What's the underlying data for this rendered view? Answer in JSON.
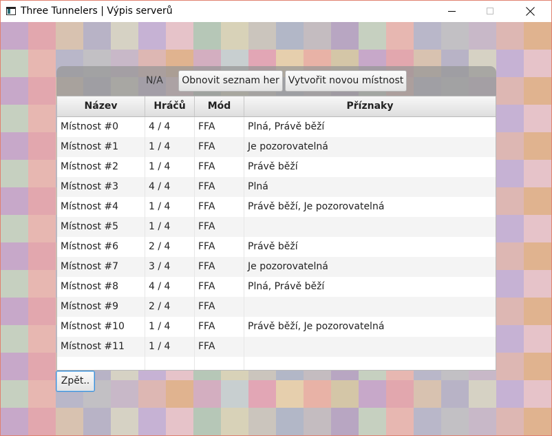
{
  "window": {
    "title": "Three Tunnelers | Výpis serverů"
  },
  "toolbar": {
    "status": "N/A",
    "refresh_label": "Obnovit seznam her",
    "create_label": "Vytvořit novou místnost"
  },
  "table": {
    "columns": [
      "Název",
      "Hráčů",
      "Mód",
      "Příznaky"
    ],
    "rows": [
      [
        "Místnost #0",
        "4 / 4",
        "FFA",
        "Plná, Právě běží"
      ],
      [
        "Místnost #1",
        "1 / 4",
        "FFA",
        "Je pozorovatelná"
      ],
      [
        "Místnost #2",
        "1 / 4",
        "FFA",
        "Právě běží"
      ],
      [
        "Místnost #3",
        "4 / 4",
        "FFA",
        "Plná"
      ],
      [
        "Místnost #4",
        "1 / 4",
        "FFA",
        "Právě běží, Je pozorovatelná"
      ],
      [
        "Místnost #5",
        "1 / 4",
        "FFA",
        ""
      ],
      [
        "Místnost #6",
        "2 / 4",
        "FFA",
        "Právě běží"
      ],
      [
        "Místnost #7",
        "3 / 4",
        "FFA",
        "Je pozorovatelná"
      ],
      [
        "Místnost #8",
        "4 / 4",
        "FFA",
        "Plná, Právě běží"
      ],
      [
        "Místnost #9",
        "2 / 4",
        "FFA",
        ""
      ],
      [
        "Místnost #10",
        "1 / 4",
        "FFA",
        "Právě běží, Je pozorovatelná"
      ],
      [
        "Místnost #11",
        "1 / 4",
        "FFA",
        ""
      ]
    ]
  },
  "footer": {
    "back_label": "Zpět.."
  }
}
